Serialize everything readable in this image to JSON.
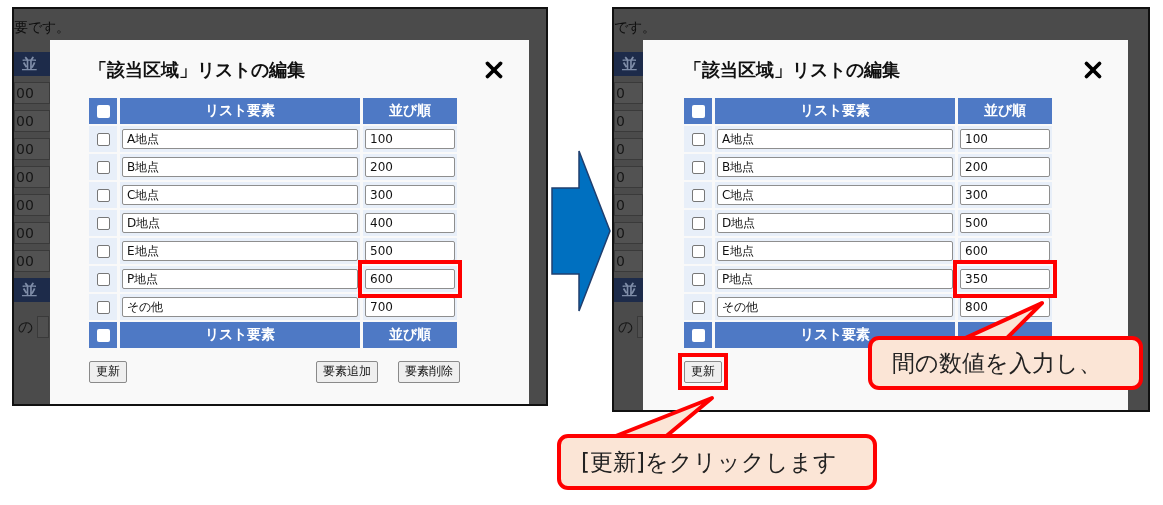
{
  "screens": [
    {
      "page_text": "要です。",
      "background_header": "並",
      "background_cells": [
        "00",
        "00",
        "00",
        "00",
        "00",
        "00",
        "00"
      ],
      "background_footer_header": "並",
      "background_label": "の",
      "dialog": {
        "title": "「該当区域」リストの編集",
        "header_all_checked": false,
        "columns": [
          "リスト要素",
          "並び順"
        ],
        "rows": [
          {
            "name": "A地点",
            "order": "100",
            "checked": false,
            "highlighted": false
          },
          {
            "name": "B地点",
            "order": "200",
            "checked": false,
            "highlighted": false
          },
          {
            "name": "C地点",
            "order": "300",
            "checked": false,
            "highlighted": false
          },
          {
            "name": "D地点",
            "order": "400",
            "checked": false,
            "highlighted": false
          },
          {
            "name": "E地点",
            "order": "500",
            "checked": false,
            "highlighted": false
          },
          {
            "name": "P地点",
            "order": "600",
            "checked": false,
            "highlighted": true
          },
          {
            "name": "その他",
            "order": "700",
            "checked": false,
            "highlighted": false
          }
        ],
        "footer_all_checked": false,
        "footer_columns": [
          "リスト要素",
          "並び順"
        ],
        "buttons": [
          {
            "label": "更新",
            "highlighted": false
          },
          {
            "label": "要素追加",
            "highlighted": false
          },
          {
            "label": "要素削除",
            "highlighted": false
          }
        ]
      }
    },
    {
      "page_text": "です。",
      "background_header": "並",
      "background_cells": [
        "0",
        "0",
        "0",
        "0",
        "0",
        "0",
        "0"
      ],
      "background_footer_header": "並",
      "background_label": "の",
      "dialog": {
        "title": "「該当区域」リストの編集",
        "header_all_checked": false,
        "columns": [
          "リスト要素",
          "並び順"
        ],
        "rows": [
          {
            "name": "A地点",
            "order": "100",
            "checked": false,
            "highlighted": false
          },
          {
            "name": "B地点",
            "order": "200",
            "checked": false,
            "highlighted": false
          },
          {
            "name": "C地点",
            "order": "300",
            "checked": false,
            "highlighted": false
          },
          {
            "name": "D地点",
            "order": "500",
            "checked": false,
            "highlighted": false
          },
          {
            "name": "E地点",
            "order": "600",
            "checked": false,
            "highlighted": false
          },
          {
            "name": "P地点",
            "order": "350",
            "checked": false,
            "highlighted": true
          },
          {
            "name": "その他",
            "order": "800",
            "checked": false,
            "highlighted": false
          }
        ],
        "footer_all_checked": false,
        "footer_columns": [
          "リスト要素"
        ],
        "buttons": [
          {
            "label": "更新",
            "highlighted": true
          }
        ]
      }
    }
  ],
  "callouts": [
    {
      "text": "間の数値を入力し、"
    },
    {
      "text": "[更新]をクリックします"
    }
  ]
}
